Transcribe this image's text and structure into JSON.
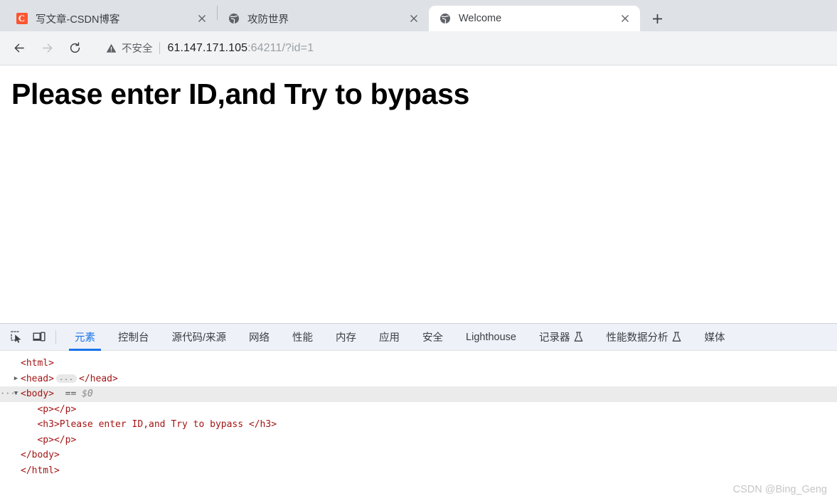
{
  "browser": {
    "tabs": [
      {
        "title": "写文章-CSDN博客",
        "favicon": "csdn-logo-icon",
        "active": false,
        "close_label": "×"
      },
      {
        "title": "攻防世界",
        "favicon": "globe-icon",
        "active": false,
        "close_label": "×"
      },
      {
        "title": "Welcome",
        "favicon": "globe-icon",
        "active": true,
        "close_label": "×"
      }
    ],
    "new_tab_label": "+",
    "nav": {
      "back_label": "←",
      "forward_label": "→",
      "reload_label": "⟳"
    },
    "omnibox": {
      "security_label": "不安全",
      "security_icon": "warning-triangle-icon",
      "url_host": "61.147.171.105",
      "url_rest": ":64211/?id=1",
      "url_full": "61.147.171.105:64211/?id=1"
    }
  },
  "page": {
    "heading": "Please enter ID,and Try to bypass"
  },
  "devtools": {
    "icons": {
      "inspect": "inspect-element-icon",
      "device": "device-toolbar-icon"
    },
    "tabs": [
      {
        "label": "元素",
        "active": true,
        "icon": ""
      },
      {
        "label": "控制台",
        "active": false,
        "icon": ""
      },
      {
        "label": "源代码/来源",
        "active": false,
        "icon": ""
      },
      {
        "label": "网络",
        "active": false,
        "icon": ""
      },
      {
        "label": "性能",
        "active": false,
        "icon": ""
      },
      {
        "label": "内存",
        "active": false,
        "icon": ""
      },
      {
        "label": "应用",
        "active": false,
        "icon": ""
      },
      {
        "label": "安全",
        "active": false,
        "icon": ""
      },
      {
        "label": "Lighthouse",
        "active": false,
        "icon": ""
      },
      {
        "label": "记录器",
        "active": false,
        "icon": "flask-icon"
      },
      {
        "label": "性能数据分析",
        "active": false,
        "icon": "flask-icon"
      },
      {
        "label": "媒体",
        "active": false,
        "icon": ""
      }
    ],
    "dom": {
      "row_html_open": "<html>",
      "row_head": "<head>",
      "row_head_close": "</head>",
      "row_head_ellipsis": "...",
      "row_body": "<body>",
      "row_body_marker": "== $0",
      "row_p1": "<p></p>",
      "row_h3": "<h3>Please enter ID,and Try to bypass </h3>",
      "row_p2": "<p></p>",
      "row_body_close": "</body>",
      "row_html_close": "</html>",
      "gutter_dots": "···",
      "twisty_collapsed": "▶",
      "twisty_expanded": "▼"
    }
  },
  "watermark": "CSDN @Bing_Geng"
}
